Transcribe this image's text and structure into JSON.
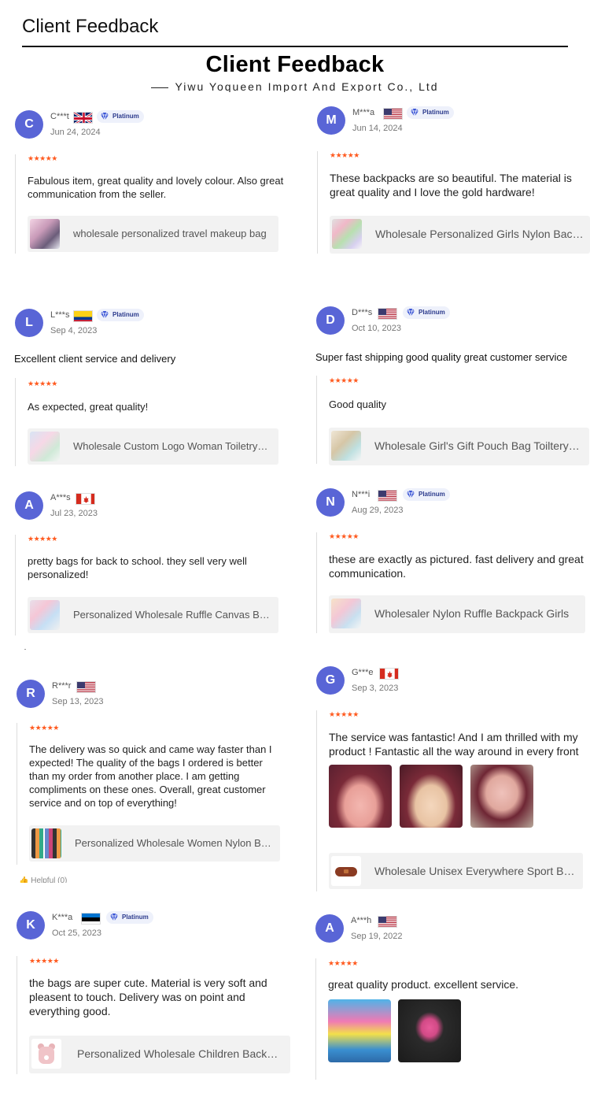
{
  "header": {
    "title": "Client Feedback"
  },
  "banner": {
    "title": "Client Feedback",
    "subtitle": "Yiwu Yoqueen Import And Export Co., Ltd"
  },
  "stars": "★★★★★",
  "badge_label": "Platinum",
  "colors": {
    "avatar": "#5965d6",
    "stars": "#ff5a1f",
    "product_bg": "#f2f2f2",
    "badge_bg": "#eef1fb"
  },
  "reviews": [
    {
      "initial": "C",
      "name": "C***t",
      "flag": "gb-flag",
      "platinum": true,
      "date": "Jun 24, 2024",
      "extra": "",
      "comment": "Fabulous item, great quality and lovely colour. Also great communication from the seller.",
      "product": "wholesale personalized travel makeup bag",
      "photos": []
    },
    {
      "initial": "M",
      "name": "M***a",
      "flag": "us-flag",
      "platinum": true,
      "date": "Jun 14, 2024",
      "extra": "",
      "comment": "These backpacks are so beautiful. The material is great quality and I love the gold hardware!",
      "product": "Wholesale Personalized Girls Nylon Backpack",
      "photos": []
    },
    {
      "initial": "L",
      "name": "L***s",
      "flag": "co-flag",
      "platinum": true,
      "date": "Sep 4, 2023",
      "extra": "Excellent client service and delivery",
      "comment": "As expected, great quality!",
      "product": "Wholesale Custom Logo Woman Toiletry Bag",
      "photos": []
    },
    {
      "initial": "D",
      "name": "D***s",
      "flag": "us-flag",
      "platinum": true,
      "date": "Oct 10, 2023",
      "extra": "Super fast shipping good quality great customer service",
      "comment": "Good quality",
      "product": "Wholesale Girl's Gift Pouch Bag Toiltery Bag",
      "photos": []
    },
    {
      "initial": "A",
      "name": "A***s",
      "flag": "ca-flag",
      "platinum": false,
      "date": "Jul 23, 2023",
      "extra": "",
      "comment": "pretty bags for back to school. they sell very well personalized!",
      "product": "Personalized Wholesale Ruffle Canvas Backpack",
      "photos": []
    },
    {
      "initial": "N",
      "name": "N***i",
      "flag": "us-flag",
      "platinum": true,
      "date": "Aug 29, 2023",
      "extra": "",
      "comment": "these are exactly as pictured. fast delivery and great communication.",
      "product": "Wholesaler Nylon Ruffle Backpack Girls",
      "photos": []
    },
    {
      "initial": "R",
      "name": "R***r",
      "flag": "us-flag",
      "platinum": false,
      "date": "Sep 13, 2023",
      "extra": "",
      "comment": "The delivery was so quick and came way faster than I expected! The quality of the bags I ordered is better than my order from another place. I am getting compliments on these ones. Overall, great customer service and on top of everything!",
      "product": "Personalized Wholesale Women Nylon Belt Bag",
      "photos": [],
      "helpful": "Helpful (0)"
    },
    {
      "initial": "G",
      "name": "G***e",
      "flag": "ca-flag",
      "platinum": false,
      "date": "Sep 3, 2023",
      "extra": "",
      "comment": "The service was fantastic! And I am thrilled with my product ! Fantastic all the way around in every front",
      "product": "Wholesale Unisex Everywhere Sport Belt Bag",
      "photos": [
        "review-photo-1",
        "review-photo-2",
        "review-photo-3"
      ]
    },
    {
      "initial": "K",
      "name": "K***a",
      "flag": "ee-flag",
      "platinum": true,
      "date": "Oct 25, 2023",
      "extra": "",
      "comment": "the bags are super cute. Material is very soft and pleasent to touch. Delivery was on point and everything good.",
      "product": "Personalized Wholesale Children Backpack",
      "photos": []
    },
    {
      "initial": "A",
      "name": "A***h",
      "flag": "us-flag",
      "platinum": false,
      "date": "Sep 19, 2022",
      "extra": "",
      "comment": "great quality product. excellent service.",
      "product": "",
      "photos": [
        "review-photo-1",
        "review-photo-2"
      ]
    }
  ]
}
